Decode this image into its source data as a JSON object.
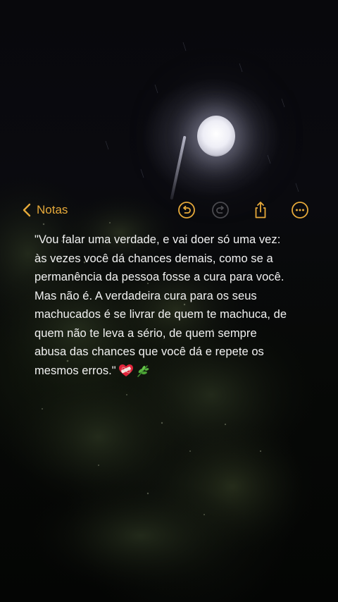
{
  "toolbar": {
    "back_label": "Notas",
    "icons": [
      "chevron-left-icon",
      "undo-icon",
      "redo-icon",
      "share-icon",
      "more-icon"
    ],
    "accent_color": "#e6a93a"
  },
  "note": {
    "lines": [
      "\"Vou falar uma verdade, e vai doer só uma vez:",
      "às vezes você dá chances demais, como se a",
      "permanência da pessoa fosse a cura para você.",
      "Mas não é. A verdadeira cura para os seus",
      "machucados é se livrar de quem te machuca, de",
      "quem não te leva a sério, de quem sempre",
      "abusa das chances que você dá e repete os",
      "mesmos erros.\""
    ],
    "trailing_emojis": [
      "bandaged-heart-icon",
      "herb-icon"
    ]
  }
}
